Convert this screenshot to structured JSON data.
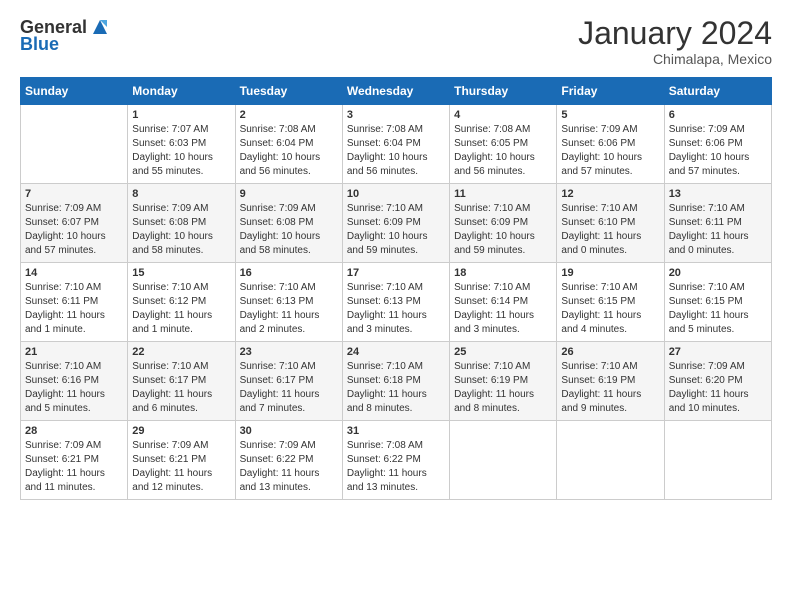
{
  "header": {
    "logo_general": "General",
    "logo_blue": "Blue",
    "title": "January 2024",
    "subtitle": "Chimalapa, Mexico"
  },
  "columns": [
    "Sunday",
    "Monday",
    "Tuesday",
    "Wednesday",
    "Thursday",
    "Friday",
    "Saturday"
  ],
  "weeks": [
    {
      "days": [
        {
          "num": "",
          "info": ""
        },
        {
          "num": "1",
          "info": "Sunrise: 7:07 AM\nSunset: 6:03 PM\nDaylight: 10 hours\nand 55 minutes."
        },
        {
          "num": "2",
          "info": "Sunrise: 7:08 AM\nSunset: 6:04 PM\nDaylight: 10 hours\nand 56 minutes."
        },
        {
          "num": "3",
          "info": "Sunrise: 7:08 AM\nSunset: 6:04 PM\nDaylight: 10 hours\nand 56 minutes."
        },
        {
          "num": "4",
          "info": "Sunrise: 7:08 AM\nSunset: 6:05 PM\nDaylight: 10 hours\nand 56 minutes."
        },
        {
          "num": "5",
          "info": "Sunrise: 7:09 AM\nSunset: 6:06 PM\nDaylight: 10 hours\nand 57 minutes."
        },
        {
          "num": "6",
          "info": "Sunrise: 7:09 AM\nSunset: 6:06 PM\nDaylight: 10 hours\nand 57 minutes."
        }
      ]
    },
    {
      "days": [
        {
          "num": "7",
          "info": "Sunrise: 7:09 AM\nSunset: 6:07 PM\nDaylight: 10 hours\nand 57 minutes."
        },
        {
          "num": "8",
          "info": "Sunrise: 7:09 AM\nSunset: 6:08 PM\nDaylight: 10 hours\nand 58 minutes."
        },
        {
          "num": "9",
          "info": "Sunrise: 7:09 AM\nSunset: 6:08 PM\nDaylight: 10 hours\nand 58 minutes."
        },
        {
          "num": "10",
          "info": "Sunrise: 7:10 AM\nSunset: 6:09 PM\nDaylight: 10 hours\nand 59 minutes."
        },
        {
          "num": "11",
          "info": "Sunrise: 7:10 AM\nSunset: 6:09 PM\nDaylight: 10 hours\nand 59 minutes."
        },
        {
          "num": "12",
          "info": "Sunrise: 7:10 AM\nSunset: 6:10 PM\nDaylight: 11 hours\nand 0 minutes."
        },
        {
          "num": "13",
          "info": "Sunrise: 7:10 AM\nSunset: 6:11 PM\nDaylight: 11 hours\nand 0 minutes."
        }
      ]
    },
    {
      "days": [
        {
          "num": "14",
          "info": "Sunrise: 7:10 AM\nSunset: 6:11 PM\nDaylight: 11 hours\nand 1 minute."
        },
        {
          "num": "15",
          "info": "Sunrise: 7:10 AM\nSunset: 6:12 PM\nDaylight: 11 hours\nand 1 minute."
        },
        {
          "num": "16",
          "info": "Sunrise: 7:10 AM\nSunset: 6:13 PM\nDaylight: 11 hours\nand 2 minutes."
        },
        {
          "num": "17",
          "info": "Sunrise: 7:10 AM\nSunset: 6:13 PM\nDaylight: 11 hours\nand 3 minutes."
        },
        {
          "num": "18",
          "info": "Sunrise: 7:10 AM\nSunset: 6:14 PM\nDaylight: 11 hours\nand 3 minutes."
        },
        {
          "num": "19",
          "info": "Sunrise: 7:10 AM\nSunset: 6:15 PM\nDaylight: 11 hours\nand 4 minutes."
        },
        {
          "num": "20",
          "info": "Sunrise: 7:10 AM\nSunset: 6:15 PM\nDaylight: 11 hours\nand 5 minutes."
        }
      ]
    },
    {
      "days": [
        {
          "num": "21",
          "info": "Sunrise: 7:10 AM\nSunset: 6:16 PM\nDaylight: 11 hours\nand 5 minutes."
        },
        {
          "num": "22",
          "info": "Sunrise: 7:10 AM\nSunset: 6:17 PM\nDaylight: 11 hours\nand 6 minutes."
        },
        {
          "num": "23",
          "info": "Sunrise: 7:10 AM\nSunset: 6:17 PM\nDaylight: 11 hours\nand 7 minutes."
        },
        {
          "num": "24",
          "info": "Sunrise: 7:10 AM\nSunset: 6:18 PM\nDaylight: 11 hours\nand 8 minutes."
        },
        {
          "num": "25",
          "info": "Sunrise: 7:10 AM\nSunset: 6:19 PM\nDaylight: 11 hours\nand 8 minutes."
        },
        {
          "num": "26",
          "info": "Sunrise: 7:10 AM\nSunset: 6:19 PM\nDaylight: 11 hours\nand 9 minutes."
        },
        {
          "num": "27",
          "info": "Sunrise: 7:09 AM\nSunset: 6:20 PM\nDaylight: 11 hours\nand 10 minutes."
        }
      ]
    },
    {
      "days": [
        {
          "num": "28",
          "info": "Sunrise: 7:09 AM\nSunset: 6:21 PM\nDaylight: 11 hours\nand 11 minutes."
        },
        {
          "num": "29",
          "info": "Sunrise: 7:09 AM\nSunset: 6:21 PM\nDaylight: 11 hours\nand 12 minutes."
        },
        {
          "num": "30",
          "info": "Sunrise: 7:09 AM\nSunset: 6:22 PM\nDaylight: 11 hours\nand 13 minutes."
        },
        {
          "num": "31",
          "info": "Sunrise: 7:08 AM\nSunset: 6:22 PM\nDaylight: 11 hours\nand 13 minutes."
        },
        {
          "num": "",
          "info": ""
        },
        {
          "num": "",
          "info": ""
        },
        {
          "num": "",
          "info": ""
        }
      ]
    }
  ]
}
